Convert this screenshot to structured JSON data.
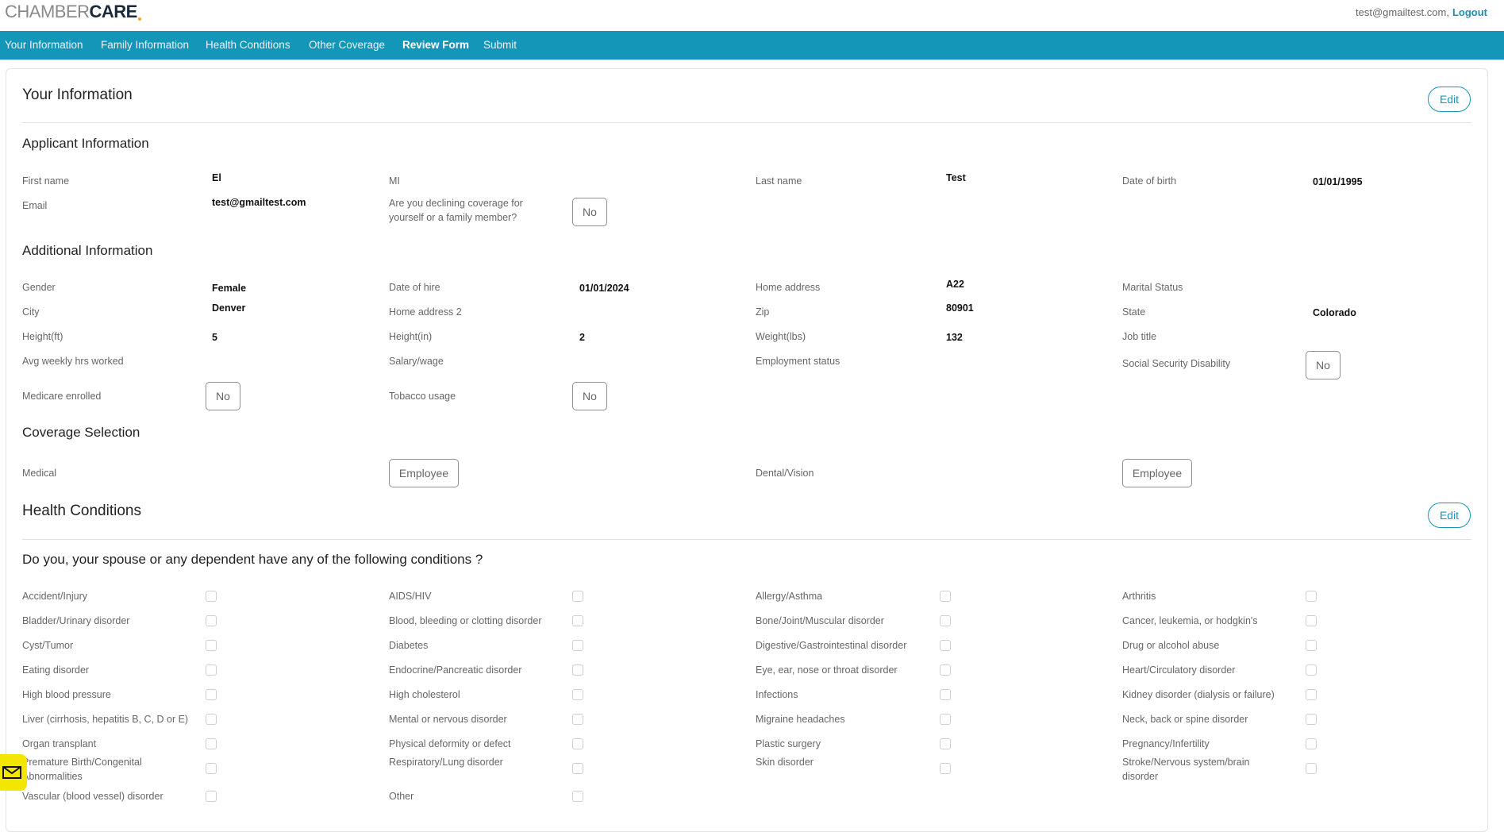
{
  "brand": {
    "name_light": "CHAMBER",
    "name_bold": "CARE"
  },
  "header": {
    "user_email": "test@gmailtest.com,",
    "logout_label": "Logout"
  },
  "nav": {
    "items": [
      {
        "label": "Your Information"
      },
      {
        "label": "Family Information"
      },
      {
        "label": "Health Conditions"
      },
      {
        "label": "Other Coverage"
      },
      {
        "label": "Review Form",
        "active": true
      },
      {
        "label": "Submit"
      }
    ]
  },
  "your_information": {
    "title": "Your Information",
    "edit_label": "Edit",
    "applicant": {
      "heading": "Applicant Information",
      "first_name_label": "First name",
      "first_name": "El",
      "mi_label": "MI",
      "mi": "",
      "last_name_label": "Last name",
      "last_name": "Test",
      "dob_label": "Date of birth",
      "dob": "01/01/1995",
      "email_label": "Email",
      "email": "test@gmailtest.com",
      "declining_label": "Are you declining coverage for yourself or a family member?",
      "declining": "No"
    },
    "additional": {
      "heading": "Additional Information",
      "gender_label": "Gender",
      "gender": "Female",
      "hire_label": "Date of hire",
      "hire": "01/01/2024",
      "address_label": "Home address",
      "address": "A22",
      "marital_label": "Marital Status",
      "marital": "",
      "city_label": "City",
      "city": "Denver",
      "address2_label": "Home address 2",
      "address2": "",
      "zip_label": "Zip",
      "zip": "80901",
      "state_label": "State",
      "state": "Colorado",
      "height_ft_label": "Height(ft)",
      "height_ft": "5",
      "height_in_label": "Height(in)",
      "height_in": "2",
      "weight_label": "Weight(lbs)",
      "weight": "132",
      "job_label": "Job title",
      "job": "",
      "hrs_label": "Avg weekly hrs worked",
      "hrs": "",
      "salary_label": "Salary/wage",
      "salary": "",
      "emp_status_label": "Employment status",
      "emp_status": "",
      "ssd_label": "Social Security Disability",
      "ssd": "No",
      "medicare_label": "Medicare enrolled",
      "medicare": "No",
      "tobacco_label": "Tobacco usage",
      "tobacco": "No"
    },
    "coverage": {
      "heading": "Coverage Selection",
      "medical_label": "Medical",
      "medical": "Employee",
      "dental_label": "Dental/Vision",
      "dental": "Employee"
    }
  },
  "health_conditions": {
    "title": "Health Conditions",
    "edit_label": "Edit",
    "question": "Do you, your spouse or any dependent have any of the following conditions ?",
    "conditions": [
      "Accident/Injury",
      "AIDS/HIV",
      "Allergy/Asthma",
      "Arthritis",
      "Bladder/Urinary disorder",
      "Blood, bleeding or clotting disorder",
      "Bone/Joint/Muscular disorder",
      "Cancer, leukemia, or hodgkin's",
      "Cyst/Tumor",
      "Diabetes",
      "Digestive/Gastrointestinal disorder",
      "Drug or alcohol abuse",
      "Eating disorder",
      "Endocrine/Pancreatic disorder",
      "Eye, ear, nose or throat disorder",
      "Heart/Circulatory disorder",
      "High blood pressure",
      "High cholesterol",
      "Infections",
      "Kidney disorder (dialysis or failure)",
      "Liver (cirrhosis, hepatitis B, C, D or E)",
      "Mental or nervous disorder",
      "Migraine headaches",
      "Neck, back or spine disorder",
      "Organ transplant",
      "Physical deformity or defect",
      "Plastic surgery",
      "Pregnancy/Infertility",
      "Premature Birth/Congenital Abnormalities",
      "Respiratory/Lung disorder",
      "Skin disorder",
      "Stroke/Nervous system/brain disorder",
      "Vascular (blood vessel) disorder",
      "Other"
    ]
  },
  "colors": {
    "nav_bg": "#1496b8",
    "accent": "#1496b8",
    "chat_button": "#f3e600"
  },
  "icons": {
    "chat": "envelope-icon"
  }
}
